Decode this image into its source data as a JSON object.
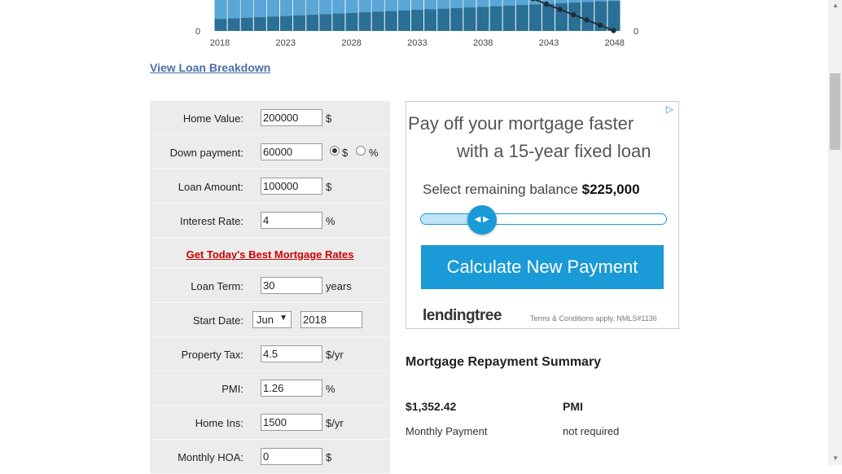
{
  "chart_data": {
    "type": "bar",
    "x_ticks": [
      "2018",
      "2023",
      "2028",
      "2033",
      "2038",
      "2043",
      "2048"
    ],
    "y_left_label": "0",
    "y_right_label": "0",
    "colors": {
      "light": "#5aa6d6",
      "dark": "#2a6f96",
      "line": "#1f2f3a"
    }
  },
  "breakdown_link": "View Loan Breakdown",
  "form": {
    "home_value": {
      "label": "Home Value:",
      "value": "200000",
      "unit": "$"
    },
    "down_payment": {
      "label": "Down payment:",
      "value": "60000",
      "unit_dollar": "$",
      "unit_percent": "%"
    },
    "loan_amount": {
      "label": "Loan Amount:",
      "value": "100000",
      "unit": "$"
    },
    "interest_rate": {
      "label": "Interest Rate:",
      "value": "4",
      "unit": "%"
    },
    "rates_link": "Get Today's Best Mortgage Rates",
    "loan_term": {
      "label": "Loan Term:",
      "value": "30",
      "unit": "years"
    },
    "start_date": {
      "label": "Start Date:",
      "month": "Jun",
      "year": "2018"
    },
    "property_tax": {
      "label": "Property Tax:",
      "value": "4.5",
      "unit": "$/yr"
    },
    "pmi": {
      "label": "PMI:",
      "value": "1.26",
      "unit": "%"
    },
    "home_ins": {
      "label": "Home Ins:",
      "value": "1500",
      "unit": "$/yr"
    },
    "monthly_hoa": {
      "label": "Monthly HOA:",
      "value": "0",
      "unit": "$"
    }
  },
  "ad": {
    "headline_1": "Pay off your mortgage faster",
    "headline_2": "with a 15-year fixed loan",
    "balance_label": "Select remaining balance",
    "balance_value": "$225,000",
    "slider_fraction": 0.25,
    "cta": "Calculate New Payment",
    "brand": "lendingtree",
    "terms": "Terms & Conditions apply. NMLS#1136",
    "accent": "#1a9ad6"
  },
  "summary": {
    "title": "Mortgage Repayment Summary",
    "monthly_payment_value": "$1,352.42",
    "monthly_payment_label": "Monthly Payment",
    "pmi_value": "PMI",
    "pmi_label": "not required"
  }
}
